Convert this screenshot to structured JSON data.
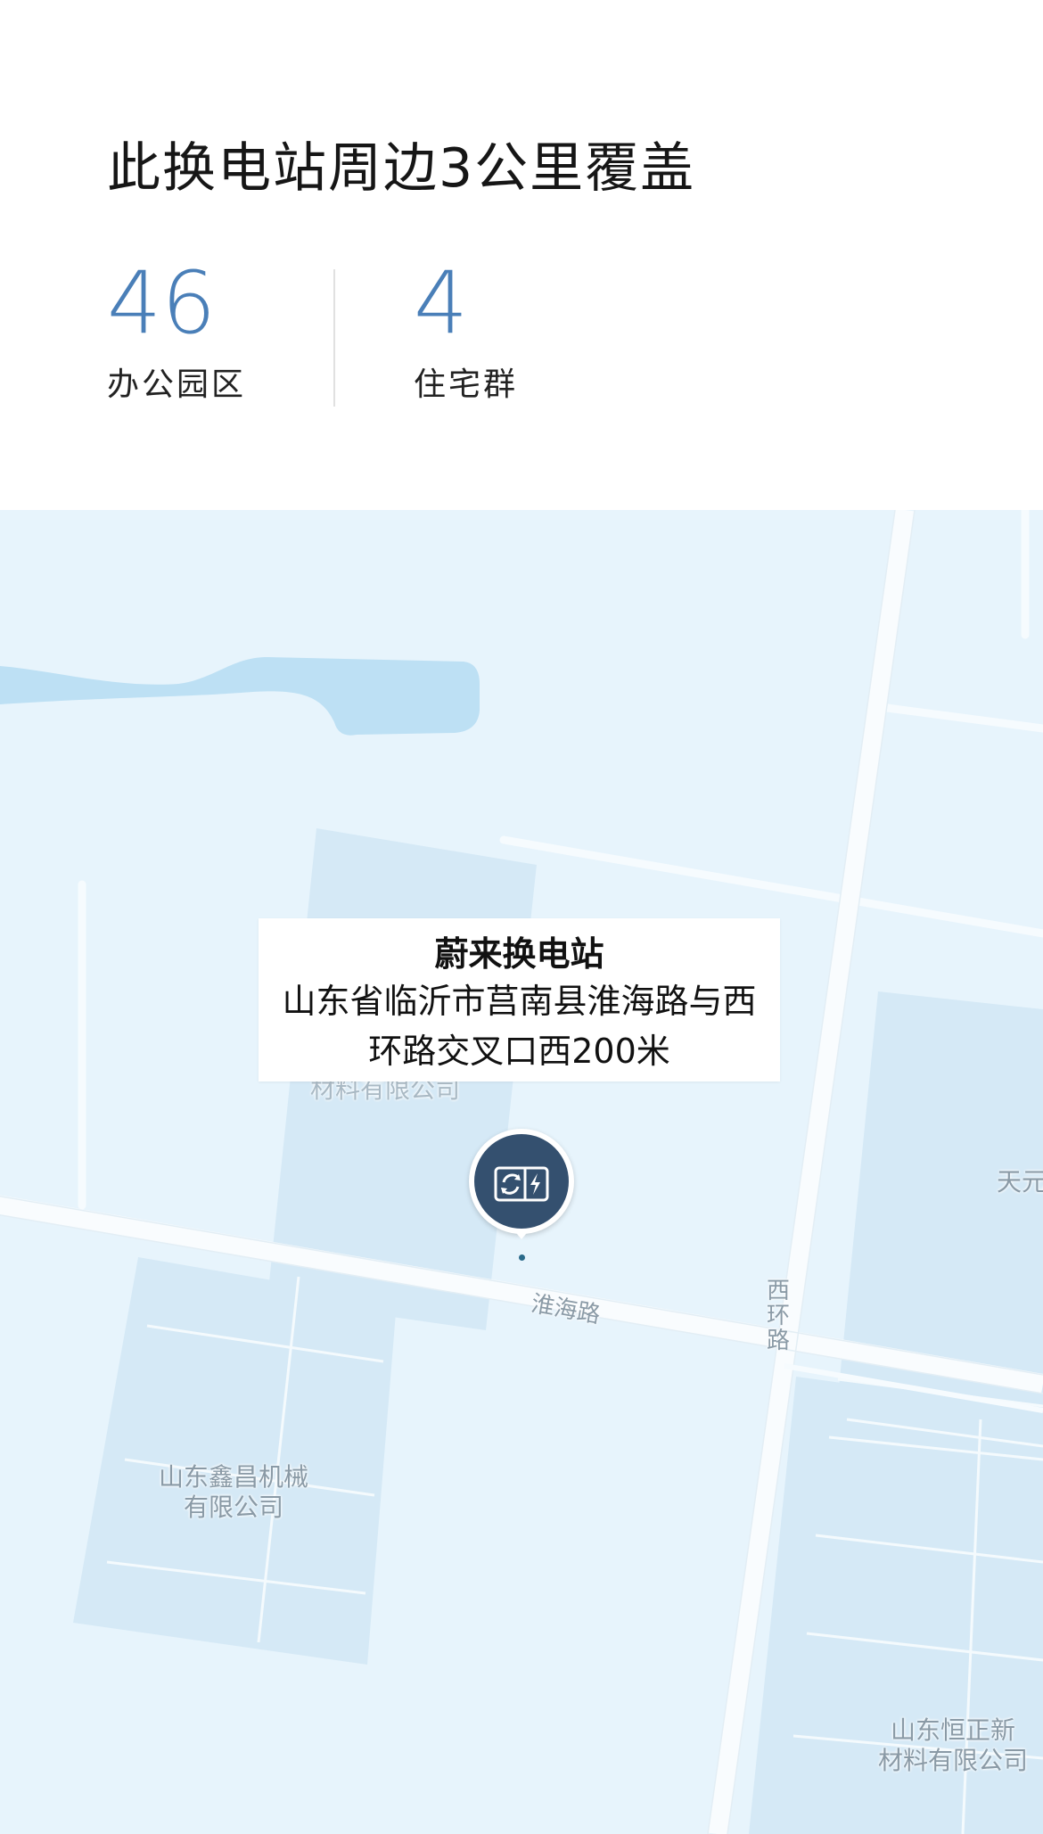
{
  "header": {
    "title": "此换电站周边3公里覆盖",
    "stats": [
      {
        "value": "46",
        "label": "办公园区"
      },
      {
        "value": "4",
        "label": "住宅群"
      }
    ]
  },
  "map": {
    "popup": {
      "name": "蔚来换电站",
      "address": "山东省临沂市莒南县淮海路与西环路交叉口西200米"
    },
    "marker_icon": "battery-swap-icon",
    "labels": {
      "road_huaihai": "淮海路",
      "road_xihuan": "西环路",
      "poi_xinchang_line1": "山东鑫昌机械",
      "poi_xinchang_line2": "有限公司",
      "poi_hengzheng_line1": "山东恒正新",
      "poi_hengzheng_line2": "材料有限公司",
      "poi_partial_top": "材料有限公司",
      "poi_tianyuan": "天元"
    },
    "colors": {
      "land": "#e7f4fc",
      "block": "#d5e9f6",
      "water": "#bde0f4",
      "road": "#f6fbfe",
      "marker": "#34506f"
    }
  }
}
